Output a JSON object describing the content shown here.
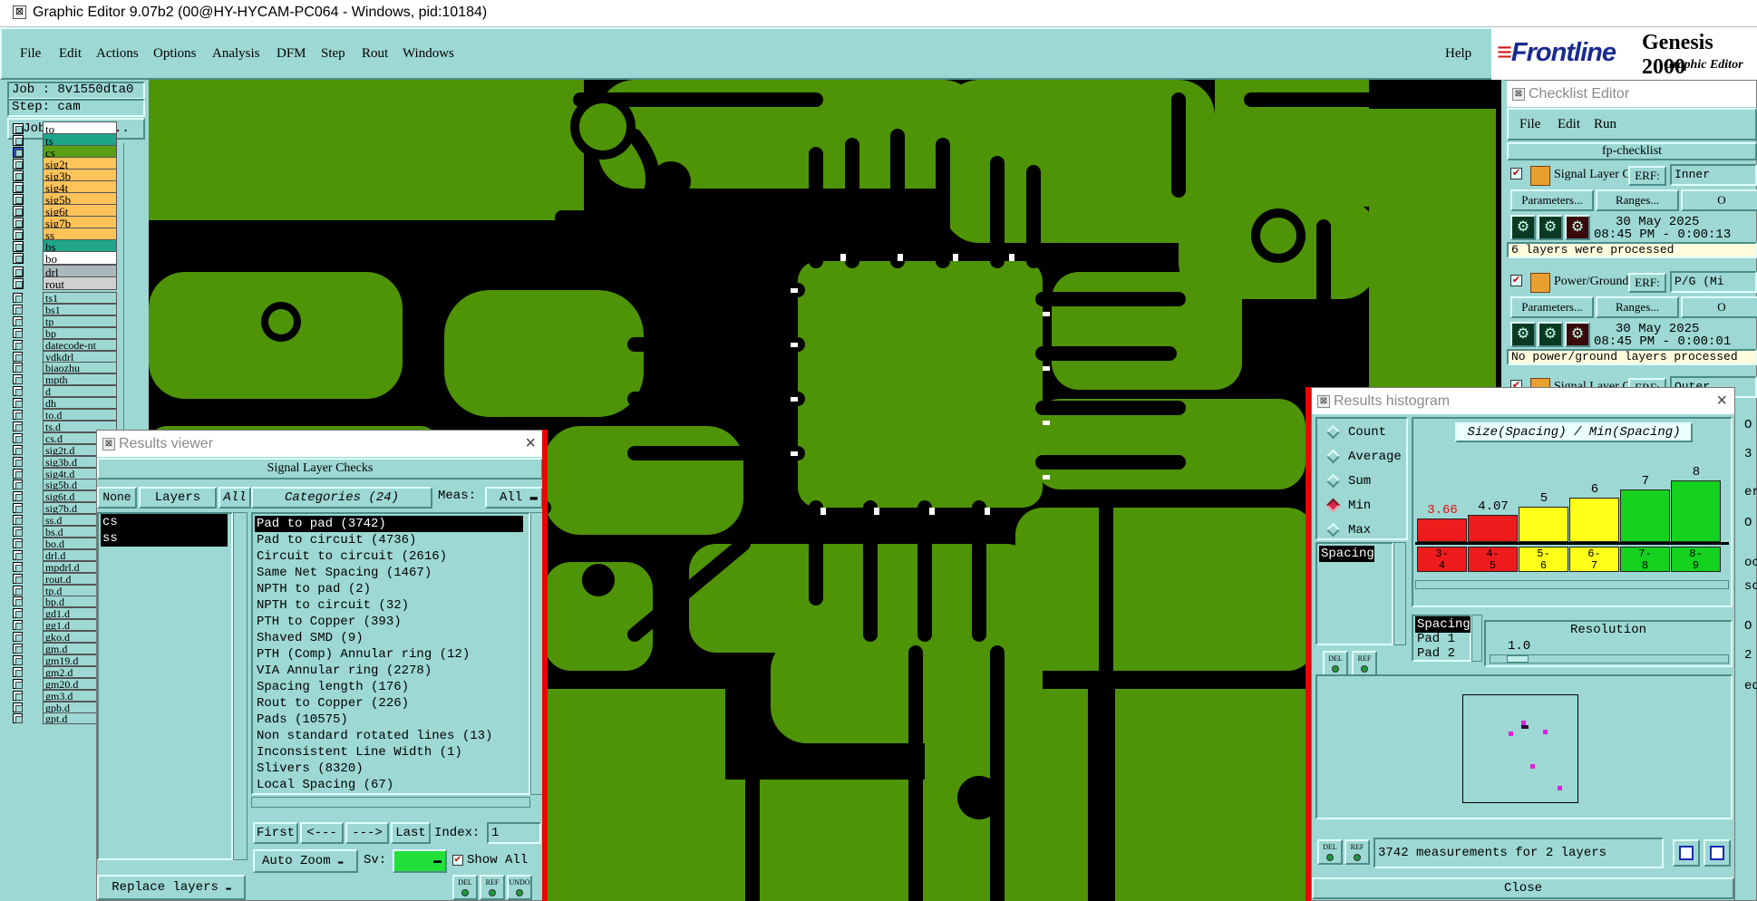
{
  "window": {
    "title": "Graphic Editor 9.07b2 (00@HY-HYCAM-PC064 - Windows, pid:10184)"
  },
  "menu": [
    "File",
    "Edit",
    "Actions",
    "Options",
    "Analysis",
    "DFM",
    "Step",
    "Rout",
    "Windows"
  ],
  "help_label": "Help",
  "brand": {
    "logo": "Frontline",
    "product": "Genesis 2000",
    "subtitle": "Graphic Editor"
  },
  "job": {
    "job_label": "Job : 8v1550dta0",
    "step_label": "Step: cam",
    "matrix_button": "Job Matrix ..."
  },
  "layers_group1": [
    {
      "name": "to",
      "color": "#ffffff"
    },
    {
      "name": "ts",
      "color": "#1ea58a"
    },
    {
      "name": "cs",
      "color": "#5aa017"
    },
    {
      "name": "sig2t",
      "color": "#ffc35a"
    },
    {
      "name": "sig3b",
      "color": "#ffc35a"
    },
    {
      "name": "sig4t",
      "color": "#ffc35a"
    },
    {
      "name": "sig5b",
      "color": "#ffc35a"
    },
    {
      "name": "sig6t",
      "color": "#ffc35a"
    },
    {
      "name": "sig7b",
      "color": "#ffc35a"
    },
    {
      "name": "ss",
      "color": "#ffc35a"
    },
    {
      "name": "bs",
      "color": "#1ea58a"
    },
    {
      "name": "bo",
      "color": "#ffffff"
    }
  ],
  "layers_group2": [
    {
      "name": "drl",
      "color": "#a8b8bc"
    },
    {
      "name": "rout",
      "color": "#d0d0d0"
    }
  ],
  "layers_group3": [
    "ts1",
    "bs1",
    "tp",
    "bp",
    "datecode-nt",
    "ydkdrl",
    "biaozhu",
    "mpth",
    "d",
    "dh",
    "to.d",
    "ts.d",
    "cs.d",
    "sig2t.d",
    "sig3b.d",
    "sig4t.d",
    "sig5b.d",
    "sig6t.d",
    "sig7b.d",
    "ss.d",
    "bs.d",
    "bo.d",
    "drl.d",
    "mpdrl.d",
    "rout.d",
    "tp.d",
    "bp.d",
    "gd1.d",
    "gg1.d",
    "gko.d",
    "gm.d",
    "gm19.d",
    "gm2.d",
    "gm20.d",
    "gm3.d",
    "gpb.d",
    "gpt.d"
  ],
  "results_viewer": {
    "title": "Results viewer",
    "header": "Signal Layer Checks",
    "none_button": "None",
    "layers_label": "Layers",
    "all_button": "All",
    "layers": [
      "cs",
      "ss"
    ],
    "categories_label": "Categories (24)",
    "meas_label": "Meas:",
    "meas_value": "All",
    "categories": [
      "Pad to pad (3742)",
      "Pad to circuit (4736)",
      "Circuit to circuit (2616)",
      "Same Net Spacing (1467)",
      "NPTH to pad (2)",
      "NPTH to circuit (32)",
      "PTH to Copper (393)",
      "Shaved SMD (9)",
      "PTH (Comp) Annular ring (12)",
      "VIA Annular ring (2278)",
      "Spacing length (176)",
      "Rout to Copper (226)",
      "Pads (10575)",
      "Non standard rotated lines (13)",
      "Inconsistent Line Width (1)",
      "Slivers (8320)",
      "Local Spacing (67)"
    ],
    "nav": {
      "first": "First",
      "prev": "<---",
      "next": "--->",
      "last": "Last",
      "index_label": "Index:",
      "index_value": "1"
    },
    "auto_zoom": "Auto Zoom",
    "sv_label": "Sv:",
    "show_all": "Show All",
    "replace_layers": "Replace layers",
    "icons": {
      "del": "DEL",
      "ref": "REF",
      "undo": "UNDO"
    }
  },
  "histogram": {
    "title": "Results histogram",
    "modes": [
      "Count",
      "Average",
      "Sum",
      "Min",
      "Max"
    ],
    "selected_mode": "Min",
    "chart_title": "Size(Spacing) / Min(Spacing)",
    "attr_list": [
      "Spacing"
    ],
    "sub_list": [
      "Spacing",
      "Pad 1",
      "Pad 2"
    ],
    "resolution_label": "Resolution",
    "resolution_value": "1.0",
    "status": "3742 measurements for 2 layers",
    "close": "Close",
    "icons": {
      "del": "DEL",
      "ref": "REF"
    }
  },
  "chart_data": {
    "type": "bar",
    "title": "Size(Spacing) / Min(Spacing)",
    "categories": [
      "3-4",
      "4-5",
      "5-6",
      "6-7",
      "7-8",
      "8-9"
    ],
    "values": [
      3.66,
      4.07,
      5,
      6,
      7,
      8
    ],
    "value_labels": [
      "3.66",
      "4.07",
      "5",
      "6",
      "7",
      "8"
    ],
    "colors": [
      "#ee1c1c",
      "#ee1c1c",
      "#ffff1a",
      "#ffff1a",
      "#14d21e",
      "#14d21e"
    ],
    "ylim": [
      0,
      8.8
    ]
  },
  "checklist": {
    "title": "Checklist Editor",
    "menu": [
      "File",
      "Edit",
      "Run"
    ],
    "name": "fp-checklist",
    "items": [
      {
        "name": "Signal Layer Ch",
        "erf_label": "ERF:",
        "erf_value": "Inner",
        "params": "Parameters...",
        "ranges": "Ranges...",
        "extra": "O",
        "date": "30 May 2025",
        "time": "08:45 PM - 0:00:13",
        "status": "6 layers were processed"
      },
      {
        "name": "Power/Ground C",
        "erf_label": "ERF:",
        "erf_value": "P/G (Mi",
        "params": "Parameters...",
        "ranges": "Ranges...",
        "extra": "O",
        "date": "30 May 2025",
        "time": "08:45 PM - 0:00:01",
        "status": "No power/ground layers processed"
      },
      {
        "name": "Signal Layer Ch",
        "erf_label": "ERF:",
        "erf_value": "Outer"
      }
    ],
    "side_fragments": [
      "O",
      "3",
      "ern",
      "O",
      "oce",
      "sci",
      "O",
      "2",
      "ed"
    ]
  }
}
